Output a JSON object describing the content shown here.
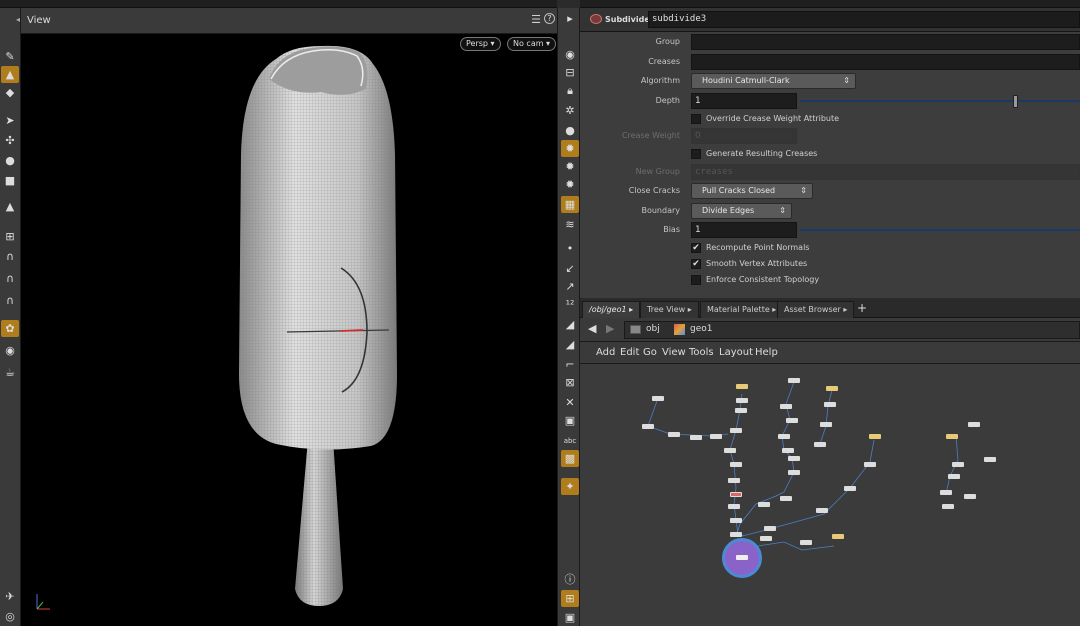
{
  "viewport": {
    "pane_title": "View",
    "camera_menu": "Persp ▾",
    "cam_menu": "No cam ▾",
    "help_icon": "?"
  },
  "param_panel": {
    "node_type": "Subdivide",
    "node_name": "subdivide3",
    "labels": {
      "group": "Group",
      "creases": "Creases",
      "algorithm": "Algorithm",
      "depth": "Depth",
      "crease_weight": "Crease Weight",
      "new_group": "New Group",
      "close_cracks": "Close Cracks",
      "boundary": "Boundary",
      "bias": "Bias"
    },
    "values": {
      "group": "",
      "creases": "",
      "algorithm": "Houdini Catmull-Clark",
      "depth": "1",
      "crease_weight": "0",
      "new_group": "creases",
      "close_cracks": "Pull Cracks Closed",
      "boundary": "Divide Edges",
      "bias": "1"
    },
    "checkboxes": {
      "override": "Override Crease Weight Attribute",
      "generate": "Generate Resulting Creases",
      "recompute": "Recompute Point Normals",
      "smooth": "Smooth Vertex Attributes",
      "enforce": "Enforce Consistent Topology"
    },
    "checked": {
      "override": false,
      "generate": false,
      "recompute": true,
      "smooth": true,
      "enforce": false
    }
  },
  "network": {
    "tabs": [
      "/obj/geo1",
      "Tree View",
      "Material Palette",
      "Asset Browser"
    ],
    "add_tab": "+",
    "path": [
      "obj",
      "geo1"
    ],
    "menu": [
      "Add",
      "Edit",
      "Go",
      "View",
      "Tools",
      "Layout",
      "Help"
    ]
  },
  "colors": {
    "accent": "#b07d1c",
    "active_node": "#8a63c8",
    "selection_ring": "#4a8bd6",
    "slider": "#1a3a66"
  }
}
